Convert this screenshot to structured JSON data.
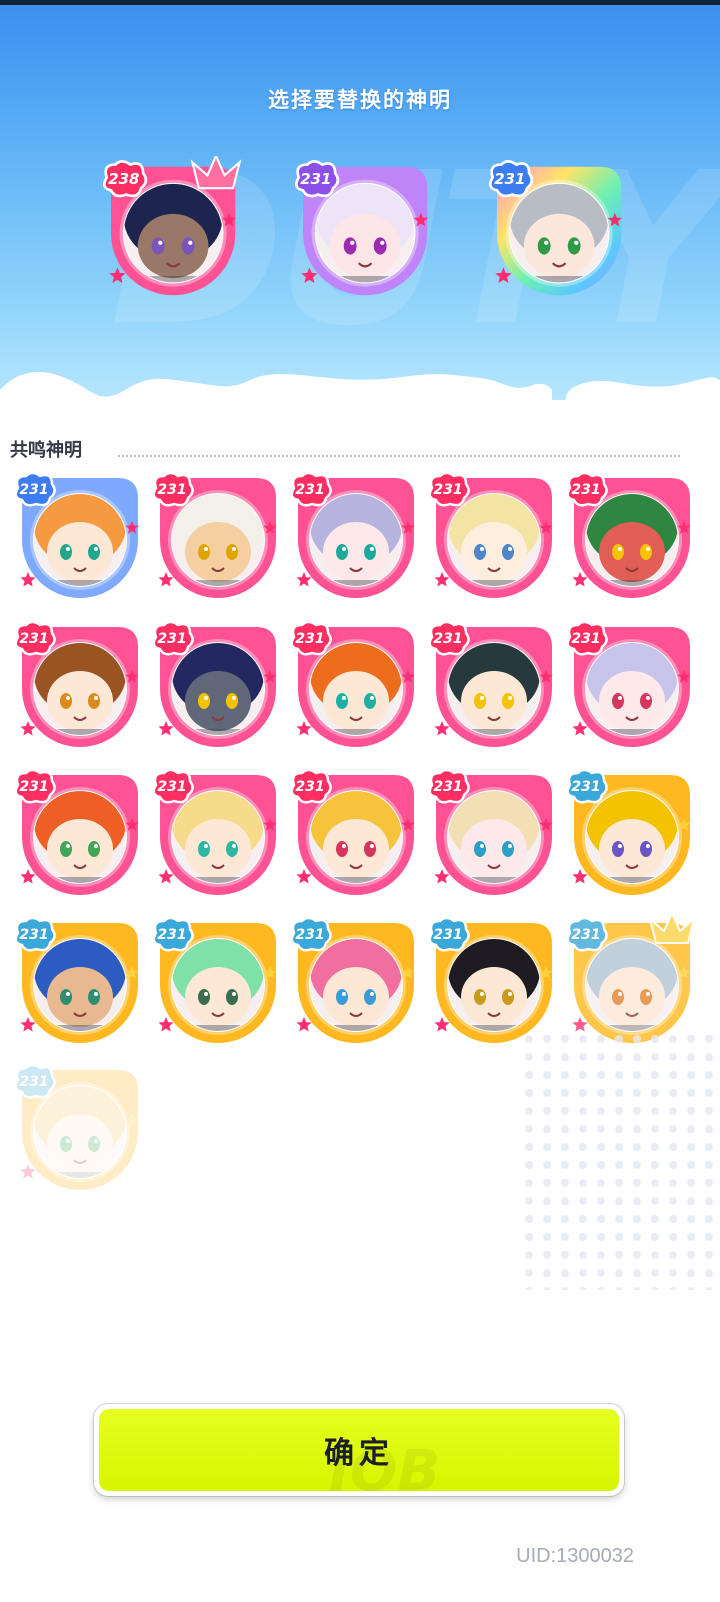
{
  "header": {
    "title": "选择要替换的神明"
  },
  "selected": [
    {
      "level": "238",
      "frame": "pink",
      "crowned": true,
      "hair": "#1e2450",
      "skin": "#9a7868",
      "eyes": "#7a54b8"
    },
    {
      "level": "231",
      "frame": "purple",
      "crowned": false,
      "hair": "#ede4f7",
      "skin": "#fde6e8",
      "eyes": "#9b2bb0"
    },
    {
      "level": "231",
      "frame": "rainbow",
      "crowned": false,
      "hair": "#b8bcc4",
      "skin": "#fbe7dc",
      "eyes": "#2f9a48"
    }
  ],
  "section": {
    "title": "共鸣神明"
  },
  "roster": [
    {
      "level": "231",
      "frame": "blue",
      "hair": "#f59a40",
      "skin": "#fde8d6",
      "eyes": "#22a68c"
    },
    {
      "level": "231",
      "frame": "pink",
      "hair": "#f3f0ea",
      "skin": "#f5cfa2",
      "eyes": "#e0a400"
    },
    {
      "level": "231",
      "frame": "pink",
      "hair": "#b6b3df",
      "skin": "#fde8ea",
      "eyes": "#1fa99d"
    },
    {
      "level": "231",
      "frame": "pink",
      "hair": "#f4e4a4",
      "skin": "#fdeede",
      "eyes": "#4f86c9"
    },
    {
      "level": "231",
      "frame": "pink",
      "hair": "#2e8640",
      "skin": "#e05e55",
      "eyes": "#f3c300"
    },
    {
      "level": "231",
      "frame": "pink",
      "hair": "#9a5322",
      "skin": "#fde7d6",
      "eyes": "#d98b1d"
    },
    {
      "level": "231",
      "frame": "pink",
      "hair": "#232860",
      "skin": "#5f6778",
      "eyes": "#f3c300"
    },
    {
      "level": "231",
      "frame": "pink",
      "hair": "#ee6d1d",
      "skin": "#fde8d6",
      "eyes": "#1fb0a5"
    },
    {
      "level": "231",
      "frame": "pink",
      "hair": "#26393c",
      "skin": "#fde8d6",
      "eyes": "#f3c300"
    },
    {
      "level": "231",
      "frame": "pink",
      "hair": "#c9c4ec",
      "skin": "#fde8ea",
      "eyes": "#d5365e"
    },
    {
      "level": "231",
      "frame": "pink",
      "hair": "#ee5f25",
      "skin": "#fde8d6",
      "eyes": "#3fa756"
    },
    {
      "level": "231",
      "frame": "pink",
      "hair": "#f5db8a",
      "skin": "#fde8d6",
      "eyes": "#2fb7a3"
    },
    {
      "level": "231",
      "frame": "pink",
      "hair": "#f5c43a",
      "skin": "#fde8d6",
      "eyes": "#d5365e"
    },
    {
      "level": "231",
      "frame": "pink",
      "hair": "#f2e0b4",
      "skin": "#fde8ea",
      "eyes": "#2b9fc5"
    },
    {
      "level": "231",
      "frame": "gold",
      "hair": "#f3c300",
      "skin": "#fde8d6",
      "eyes": "#6c54c4"
    },
    {
      "level": "231",
      "frame": "gold",
      "hair": "#2c5cbf",
      "skin": "#e8b890",
      "eyes": "#2e8f70"
    },
    {
      "level": "231",
      "frame": "gold",
      "hair": "#7fe0a8",
      "skin": "#fde8d6",
      "eyes": "#3b6e4c"
    },
    {
      "level": "231",
      "frame": "gold",
      "hair": "#f06fa0",
      "skin": "#fde8d6",
      "eyes": "#3a9bd8"
    },
    {
      "level": "231",
      "frame": "gold",
      "hair": "#1e1c22",
      "skin": "#fde8d6",
      "eyes": "#c99b1d"
    },
    {
      "level": "231",
      "frame": "gold",
      "hair": "#b3c5d4",
      "skin": "#fde8d6",
      "eyes": "#e0842c",
      "crowned": true,
      "faded": true
    },
    {
      "level": "231",
      "frame": "gold",
      "hair": "#f5c86a",
      "skin": "#fde8d6",
      "eyes": "#3fa756",
      "faded": true,
      "ghost": true
    }
  ],
  "actions": {
    "confirm_label": "确定"
  },
  "footer": {
    "uid": "UID:1300032"
  },
  "frame_colors": {
    "pink": "#ff5294",
    "purple": "#bf84f8",
    "blue": "#7fa9ff",
    "gold": "#ffb820",
    "rainbow": "#58d7ff"
  }
}
